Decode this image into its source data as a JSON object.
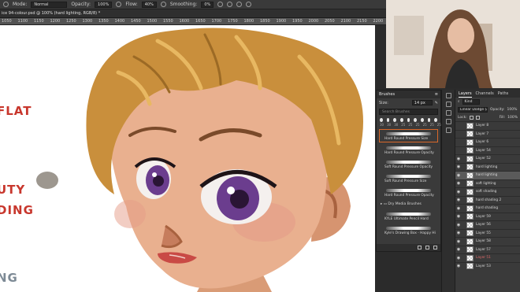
{
  "options_bar": {
    "mode_label": "Mode:",
    "mode_value": "Normal",
    "opacity_label": "Opacity:",
    "opacity_value": "100%",
    "flow_label": "Flow:",
    "flow_value": "40%",
    "smoothing_label": "Smoothing:",
    "smoothing_value": "0%"
  },
  "document_tab": {
    "title": "ice 94-colour.psd @ 100% (hard lighting, RGB/8) *"
  },
  "ruler": {
    "ticks": [
      "1050",
      "1100",
      "1150",
      "1200",
      "1250",
      "1300",
      "1350",
      "1400",
      "1450",
      "1500",
      "1550",
      "1600",
      "1650",
      "1700",
      "1750",
      "1800",
      "1850",
      "1900",
      "1950",
      "2000",
      "2050",
      "2100",
      "2150",
      "2200"
    ]
  },
  "canvas_notes": [
    "FLAT",
    "UTY",
    "DING",
    "NG"
  ],
  "brushes_panel": {
    "title": "Brushes",
    "size_label": "Size:",
    "size_value": "14 px",
    "search_placeholder": "Search Brushes",
    "preset_sizes": [
      "30",
      "30",
      "30",
      "25",
      "25",
      "25",
      "25",
      "25",
      "25"
    ],
    "items": [
      {
        "label": "Hard Round Pressure Size",
        "selected": true
      },
      {
        "label": "Hard Round Pressure Opacity",
        "selected": false
      },
      {
        "label": "Soft Round Pressure Opacity",
        "selected": false
      },
      {
        "label": "Soft Round Pressure Size",
        "selected": false
      },
      {
        "label": "Hard Round Pressure Opacity",
        "selected": false
      }
    ],
    "folder_label": "Dry Media Brushes",
    "folder_items": [
      {
        "label": "KYLE Ultimate Pencil Hard"
      },
      {
        "label": "Kyle's Drawing Box - Happy Hi"
      }
    ]
  },
  "layers_panel": {
    "tabs": [
      "Layers",
      "Channels",
      "Paths"
    ],
    "active_tab": "Layers",
    "filter_value": "Kind",
    "blend_mode": "Linear Dodge (Add)",
    "opacity_label": "Opacity:",
    "opacity_value": "100%",
    "lock_label": "Lock:",
    "fill_label": "Fill:",
    "fill_value": "100%",
    "layers": [
      {
        "name": "Layer 8",
        "visible": false,
        "selected": false,
        "red": false
      },
      {
        "name": "Layer 7",
        "visible": false,
        "selected": false,
        "red": false
      },
      {
        "name": "Layer 6",
        "visible": false,
        "selected": false,
        "red": false
      },
      {
        "name": "Layer 54",
        "visible": false,
        "selected": false,
        "red": false
      },
      {
        "name": "Layer 52",
        "visible": true,
        "selected": false,
        "red": false
      },
      {
        "name": "hard lighting",
        "visible": true,
        "selected": false,
        "red": false
      },
      {
        "name": "hard lighting",
        "visible": true,
        "selected": true,
        "red": false
      },
      {
        "name": "soft lighting",
        "visible": true,
        "selected": false,
        "red": false
      },
      {
        "name": "soft shading",
        "visible": true,
        "selected": false,
        "red": false
      },
      {
        "name": "hard shading 2",
        "visible": true,
        "selected": false,
        "red": false
      },
      {
        "name": "hard shading",
        "visible": true,
        "selected": false,
        "red": false
      },
      {
        "name": "Layer 59",
        "visible": true,
        "selected": false,
        "red": false
      },
      {
        "name": "Layer 56",
        "visible": true,
        "selected": false,
        "red": false
      },
      {
        "name": "Layer 55",
        "visible": true,
        "selected": false,
        "red": false
      },
      {
        "name": "Layer 58",
        "visible": true,
        "selected": false,
        "red": false
      },
      {
        "name": "Layer 57",
        "visible": true,
        "selected": false,
        "red": false
      },
      {
        "name": "Layer 51",
        "visible": true,
        "selected": false,
        "red": true
      },
      {
        "name": "Layer 53",
        "visible": true,
        "selected": false,
        "red": false
      }
    ]
  },
  "colors": {
    "accent_selected_brush": "#d9682a",
    "note_red": "#c8372d",
    "skin": "#e9b08f",
    "hair": "#c98f3c",
    "iris": "#6b3d8e"
  }
}
